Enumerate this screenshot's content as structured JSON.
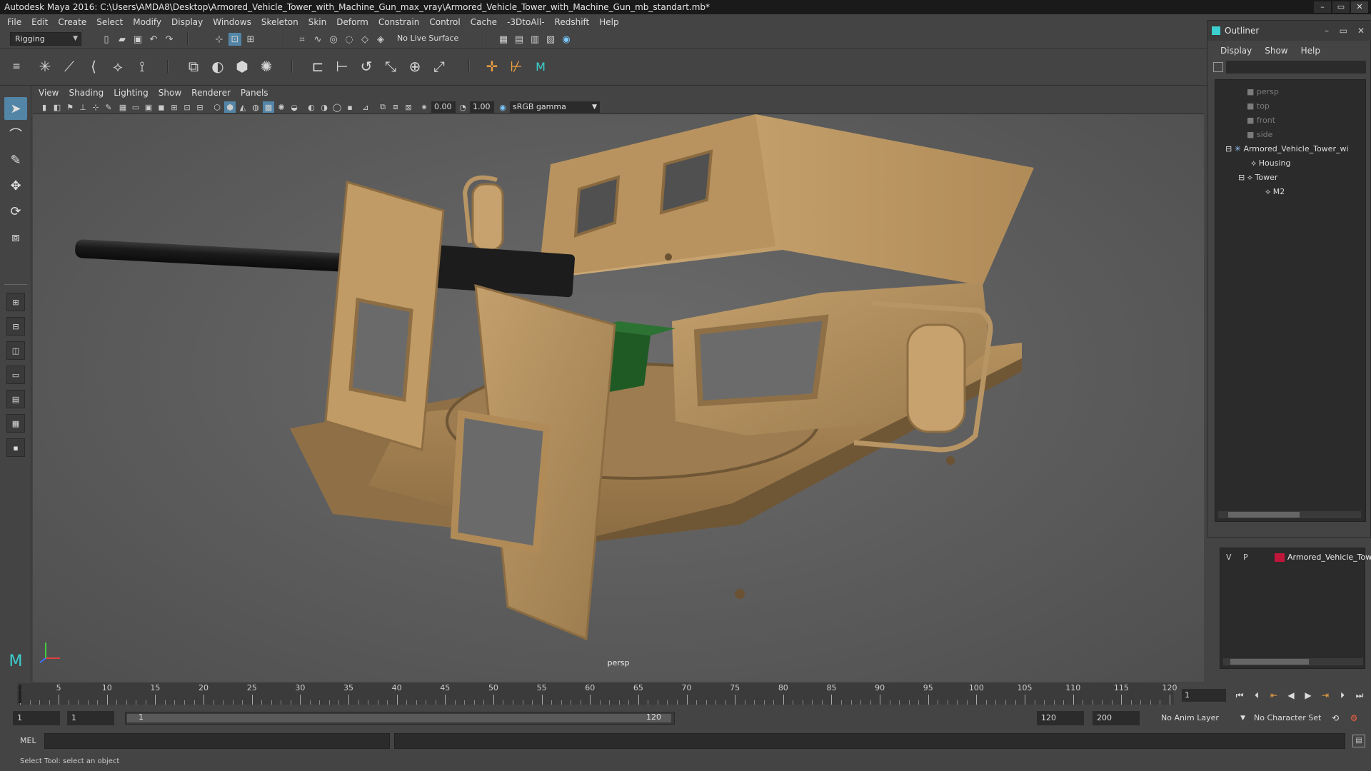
{
  "window": {
    "title": "Autodesk Maya 2016: C:\\Users\\AMDA8\\Desktop\\Armored_Vehicle_Tower_with_Machine_Gun_max_vray\\Armored_Vehicle_Tower_with_Machine_Gun_mb_standart.mb*",
    "buttons": [
      "–",
      "▭",
      "✕"
    ]
  },
  "menubar": [
    "File",
    "Edit",
    "Create",
    "Select",
    "Modify",
    "Display",
    "Windows",
    "Skeleton",
    "Skin",
    "Deform",
    "Constrain",
    "Control",
    "Cache",
    "-3DtoAll-",
    "Redshift",
    "Help"
  ],
  "statusline": {
    "menuset": "Rigging",
    "live_surface": "No Live Surface"
  },
  "panel": {
    "menus": [
      "View",
      "Shading",
      "Lighting",
      "Show",
      "Renderer",
      "Panels"
    ],
    "exposure": "0.00",
    "gamma": "1.00",
    "color_space": "sRGB gamma",
    "camera_label": "persp"
  },
  "outliner": {
    "title": "Outliner",
    "menus": [
      "Display",
      "Show",
      "Help"
    ],
    "items": [
      {
        "label": "persp",
        "type": "camera"
      },
      {
        "label": "top",
        "type": "camera"
      },
      {
        "label": "front",
        "type": "camera"
      },
      {
        "label": "side",
        "type": "camera"
      },
      {
        "label": "Armored_Vehicle_Tower_wi",
        "type": "group"
      },
      {
        "label": "Housing",
        "type": "mesh"
      },
      {
        "label": "Tower",
        "type": "mesh"
      },
      {
        "label": "M2",
        "type": "mesh"
      }
    ]
  },
  "layers": {
    "visible_flag": "V",
    "playback_flag": "P",
    "layer_name": "Armored_Vehicle_Towe",
    "layer_color": "#c0163a"
  },
  "timeline": {
    "labels": [
      "1",
      "5",
      "10",
      "15",
      "20",
      "25",
      "30",
      "35",
      "40",
      "45",
      "50",
      "55",
      "60",
      "65",
      "70",
      "75",
      "80",
      "85",
      "90",
      "95",
      "100",
      "105",
      "110",
      "115",
      "120"
    ],
    "current_frame": "1"
  },
  "range": {
    "start": "1",
    "playback_start": "1",
    "slider_start": "1",
    "slider_end": "120",
    "playback_end": "120",
    "end": "200",
    "anim_layer": "No Anim Layer",
    "character_set": "No Character Set"
  },
  "command": {
    "mel_label": "MEL",
    "help_text": "Select Tool: select an object"
  },
  "colors": {
    "accent": "#5285a6",
    "turret": "#b08d5e",
    "ammo_box": "#1f5a24"
  }
}
